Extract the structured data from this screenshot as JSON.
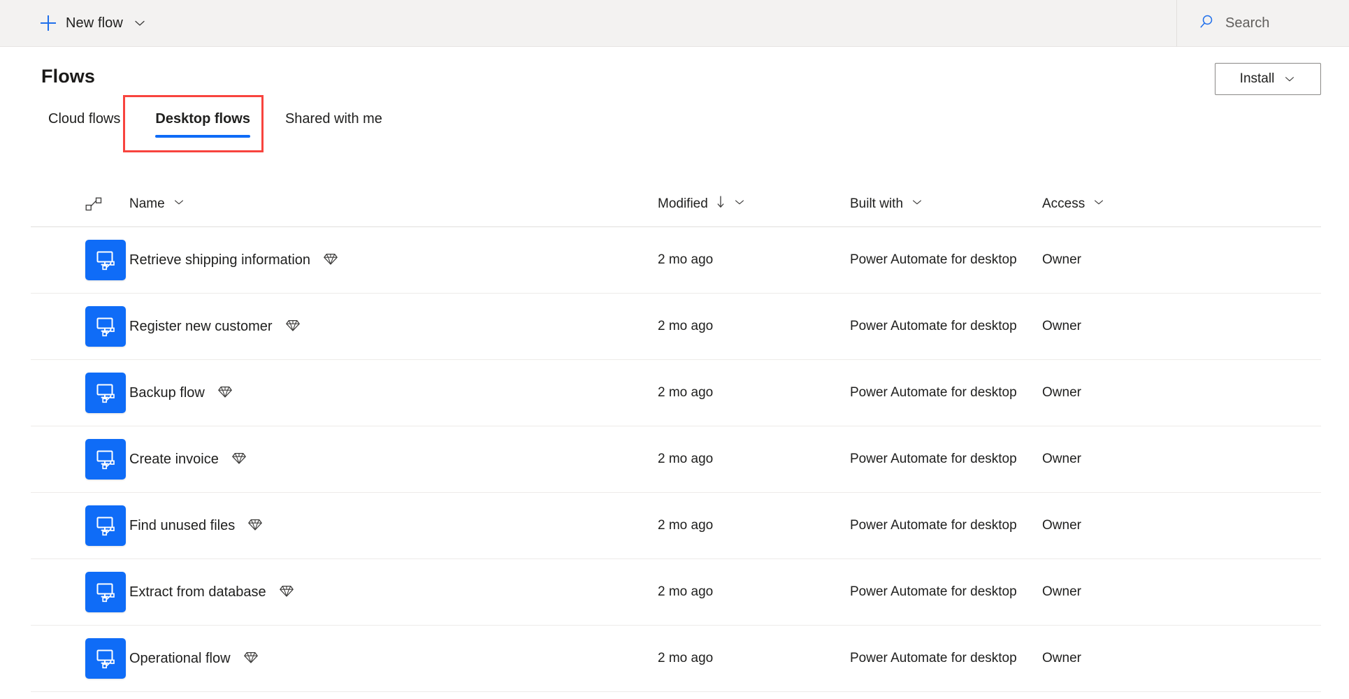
{
  "topbar": {
    "new_flow_label": "New flow",
    "new_flow_caret": "chevron-down-icon",
    "plus_icon": "plus-icon",
    "search_placeholder": "Search",
    "search_icon": "search-icon"
  },
  "page": {
    "title": "Flows",
    "install_label": "Install",
    "install_caret": "chevron-down-icon"
  },
  "tabs": [
    {
      "label": "Cloud flows",
      "selected": false
    },
    {
      "label": "Desktop flows",
      "selected": true
    },
    {
      "label": "Shared with me",
      "selected": false
    }
  ],
  "highlight": {
    "target": "Desktop flows",
    "color": "#f8443e"
  },
  "table": {
    "columns": [
      {
        "key": "flowtype",
        "label": "",
        "icon": "flow-connector-icon",
        "sortable": false
      },
      {
        "key": "name",
        "label": "Name",
        "caret": "chevron-down-icon",
        "sorted": false
      },
      {
        "key": "modified",
        "label": "Modified",
        "caret": "chevron-down-icon",
        "sorted": true,
        "sort_direction": "descending",
        "sort_glyph": "arrow-down-icon"
      },
      {
        "key": "builtwith",
        "label": "Built with",
        "caret": "chevron-down-icon",
        "sorted": false
      },
      {
        "key": "access",
        "label": "Access",
        "caret": "chevron-down-icon",
        "sorted": false
      }
    ],
    "rows": [
      {
        "icon": "desktop-flow-icon",
        "name": "Retrieve shipping information",
        "badge": "premium-diamond-icon",
        "modified": "2 mo ago",
        "built_with": "Power Automate for desktop",
        "access": "Owner"
      },
      {
        "icon": "desktop-flow-icon",
        "name": "Register new customer",
        "badge": "premium-diamond-icon",
        "modified": "2 mo ago",
        "built_with": "Power Automate for desktop",
        "access": "Owner"
      },
      {
        "icon": "desktop-flow-icon",
        "name": "Backup flow",
        "badge": "premium-diamond-icon",
        "modified": "2 mo ago",
        "built_with": "Power Automate for desktop",
        "access": "Owner"
      },
      {
        "icon": "desktop-flow-icon",
        "name": "Create invoice",
        "badge": "premium-diamond-icon",
        "modified": "2 mo ago",
        "built_with": "Power Automate for desktop",
        "access": "Owner"
      },
      {
        "icon": "desktop-flow-icon",
        "name": "Find unused files",
        "badge": "premium-diamond-icon",
        "modified": "2 mo ago",
        "built_with": "Power Automate for desktop",
        "access": "Owner"
      },
      {
        "icon": "desktop-flow-icon",
        "name": "Extract from database",
        "badge": "premium-diamond-icon",
        "modified": "2 mo ago",
        "built_with": "Power Automate for desktop",
        "access": "Owner"
      },
      {
        "icon": "desktop-flow-icon",
        "name": "Operational flow",
        "badge": "premium-diamond-icon",
        "modified": "2 mo ago",
        "built_with": "Power Automate for desktop",
        "access": "Owner"
      }
    ]
  },
  "colors": {
    "accent": "#0f6cf7",
    "topbar_bg": "#f3f2f1",
    "highlight_red": "#f8443e",
    "text": "#20201f",
    "row_divider": "#edebe9"
  }
}
